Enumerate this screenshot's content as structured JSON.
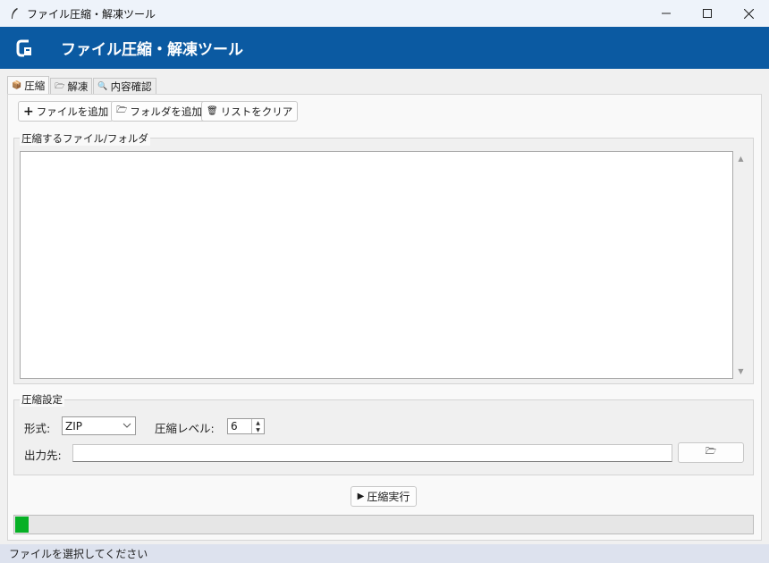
{
  "window": {
    "title": "ファイル圧縮・解凍ツール",
    "controls": {
      "minimize": "—",
      "maximize": "☐",
      "close": "✕"
    }
  },
  "header": {
    "title": "ファイル圧縮・解凍ツール",
    "logo_icon": "package-logo-icon"
  },
  "tabs": [
    {
      "label": "圧縮",
      "icon": "box-icon",
      "glyph": "📦",
      "active": true
    },
    {
      "label": "解凍",
      "icon": "folder-open-icon",
      "glyph": "🗁",
      "active": false
    },
    {
      "label": "内容確認",
      "icon": "magnifier-icon",
      "glyph": "🔍",
      "active": false
    }
  ],
  "toolbar": {
    "add_files": {
      "label": "ファイルを追加",
      "glyph": "+"
    },
    "add_folder": {
      "label": "フォルダを追加",
      "glyph": "🗁"
    },
    "clear_list": {
      "label": "リストをクリア",
      "glyph": "🗑"
    }
  },
  "files_group": {
    "label": "圧縮するファイル/フォルダ",
    "items": []
  },
  "settings": {
    "label": "圧縮設定",
    "format_label": "形式:",
    "format_value": "ZIP",
    "level_label": "圧縮レベル:",
    "level_value": "6",
    "output_label": "出力先:",
    "output_value": "",
    "browse_glyph": "🗁"
  },
  "run_button": {
    "label": "圧縮実行",
    "glyph": "▶"
  },
  "progress": {
    "fraction": 0.02,
    "color": "#06b025"
  },
  "status": {
    "text": "ファイルを選択してください"
  },
  "colors": {
    "banner": "#0b5aa2",
    "accent": "#06b025"
  }
}
